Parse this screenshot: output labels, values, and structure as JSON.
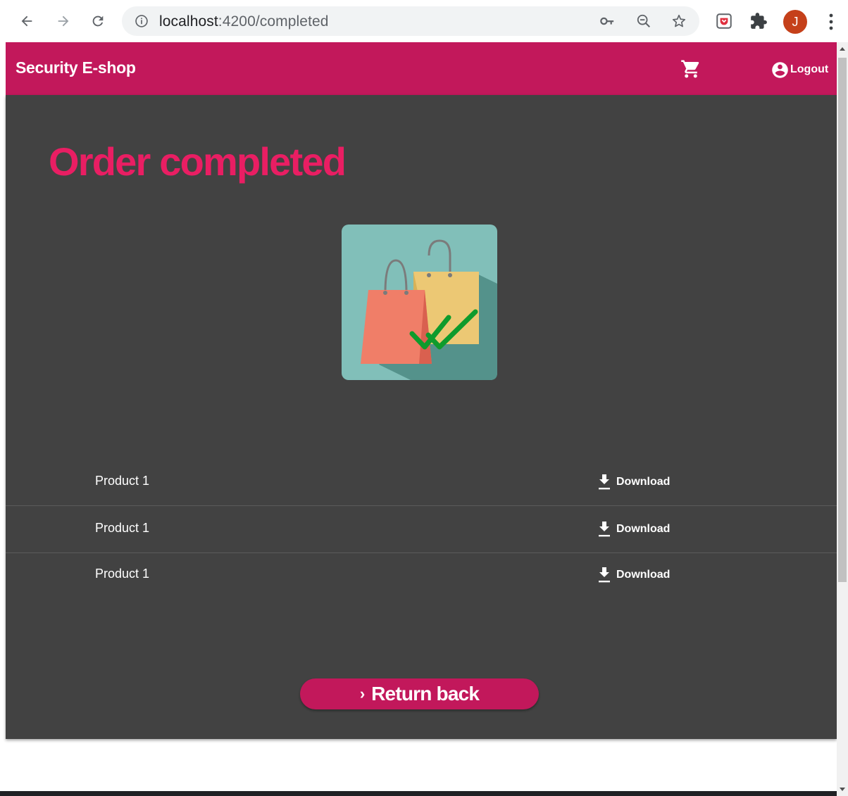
{
  "browser": {
    "url_host": "localhost",
    "url_path": ":4200/completed",
    "profile_initial": "J",
    "colors": {
      "profile": "#c5401a",
      "omnibox": "#f1f3f4"
    },
    "icons": [
      "back-icon",
      "forward-icon",
      "reload-icon",
      "info-icon",
      "key-icon",
      "zoom-out-icon",
      "star-icon",
      "pocket-icon",
      "extensions-icon",
      "menu-icon"
    ]
  },
  "app": {
    "brand": "Security E-shop",
    "logout_label": "Logout",
    "page_title": "Order completed",
    "return_label": "Return back",
    "colors": {
      "primary": "#c2185b",
      "accent": "#e91e63",
      "panel": "#424242"
    },
    "products": [
      {
        "name": "Product 1",
        "download_label": "Download"
      },
      {
        "name": "Product 1",
        "download_label": "Download"
      },
      {
        "name": "Product 1",
        "download_label": "Download"
      }
    ]
  }
}
